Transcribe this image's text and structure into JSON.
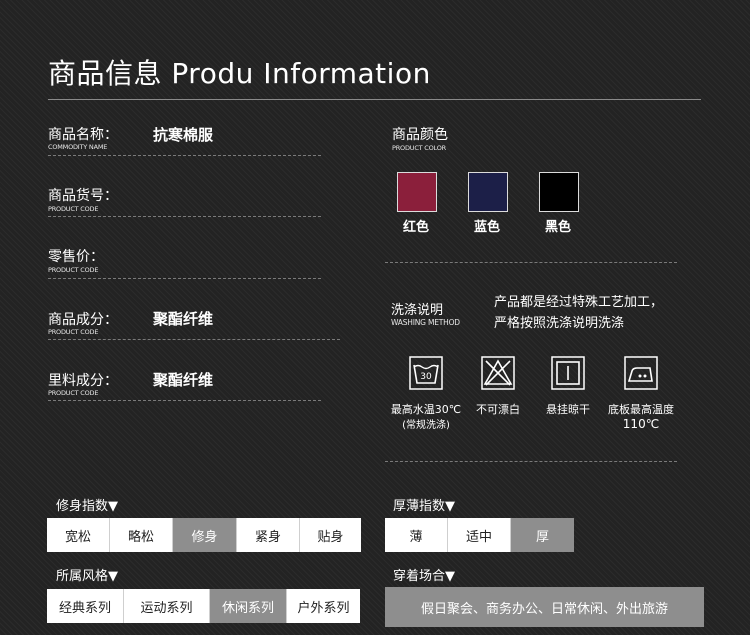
{
  "header": {
    "title": "商品信息 Produ Information"
  },
  "fields": [
    {
      "label": "商品名称：",
      "sub": "COMMODITY NAME",
      "value": "抗寒棉服"
    },
    {
      "label": "商品货号：",
      "sub": "PRODUCT CODE",
      "value": ""
    },
    {
      "label": "零售价：",
      "sub": "PRODUCT CODE",
      "value": ""
    },
    {
      "label": "商品成分：",
      "sub": "PRODUCT CODE",
      "value": "聚酯纤维"
    },
    {
      "label": "里料成分：",
      "sub": "PRODUCT CODE",
      "value": "聚酯纤维"
    }
  ],
  "colors": {
    "label": "商品颜色",
    "sub": "PRODUCT COLOR",
    "items": [
      {
        "name": "红色",
        "hex": "#8b1f3b"
      },
      {
        "name": "蓝色",
        "hex": "#1c1f48"
      },
      {
        "name": "黑色",
        "hex": "#000000"
      }
    ]
  },
  "washing": {
    "label": "洗涤说明",
    "sub": "WASHING METHOD",
    "desc_line1": "产品都是经过特殊工艺加工，",
    "desc_line2": "严格按照洗涤说明洗涤",
    "icons": [
      {
        "icon": "wash-30-icon",
        "number": "30",
        "caption_line1": "最高水温30℃",
        "caption_line2": "(常规洗涤)"
      },
      {
        "icon": "no-bleach-icon",
        "caption_line1": "不可漂白",
        "caption_line2": ""
      },
      {
        "icon": "hang-dry-icon",
        "caption_line1": "悬挂晾干",
        "caption_line2": ""
      },
      {
        "icon": "iron-medium-icon",
        "caption_line1": "底板最高温度",
        "caption_line2": "110℃"
      }
    ]
  },
  "fit": {
    "label": "修身指数▼",
    "options": [
      "宽松",
      "略松",
      "修身",
      "紧身",
      "贴身"
    ],
    "selected": 2
  },
  "thickness": {
    "label": "厚薄指数▼",
    "options": [
      "薄",
      "适中",
      "厚"
    ],
    "selected": 2
  },
  "style": {
    "label": "所属风格▼",
    "options": [
      "经典系列",
      "运动系列",
      "休闲系列",
      "户外系列"
    ],
    "selected": 2
  },
  "occasion": {
    "label": "穿着场合▼",
    "value": "假日聚会、商务办公、日常休闲、外出旅游"
  }
}
